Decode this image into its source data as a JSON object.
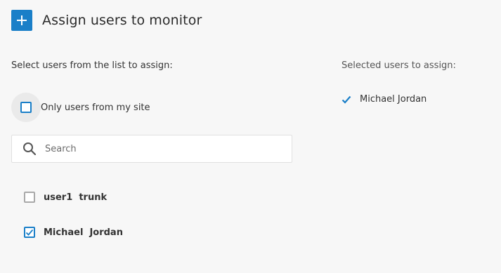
{
  "header": {
    "title": "Assign users to monitor",
    "add_icon": "plus-icon",
    "accent_color": "#1a7fc8"
  },
  "left": {
    "instruction": "Select users from the list to assign:",
    "site_filter": {
      "label": "Only users from my site",
      "checked": false
    },
    "search": {
      "placeholder": "Search",
      "value": ""
    },
    "users": [
      {
        "name": "user1  trunk",
        "checked": false
      },
      {
        "name": "Michael  Jordan",
        "checked": true
      }
    ]
  },
  "right": {
    "heading": "Selected users to assign:",
    "selected": [
      {
        "name": "Michael Jordan",
        "icon": "checkmark-icon"
      }
    ]
  }
}
